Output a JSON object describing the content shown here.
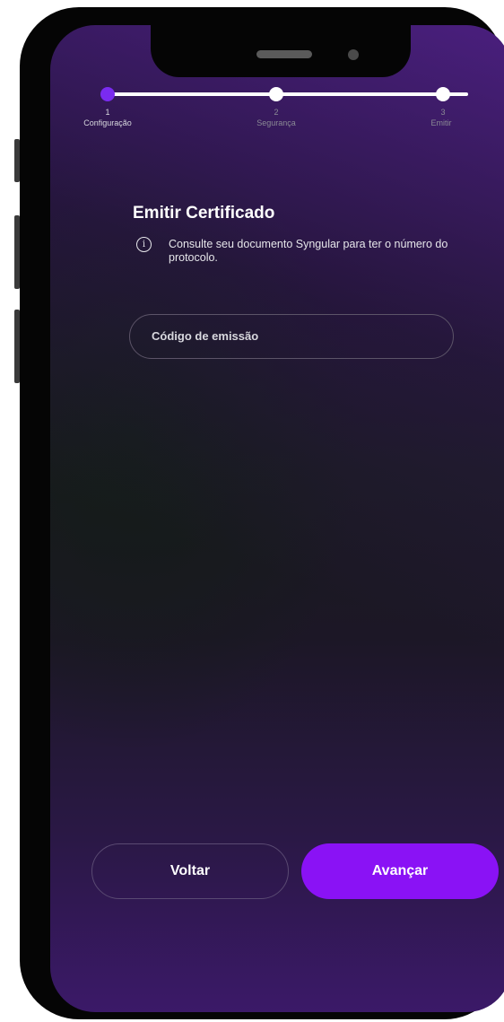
{
  "stepper": {
    "steps": [
      {
        "number": "1",
        "label": "Configuração"
      },
      {
        "number": "2",
        "label": "Segurança"
      },
      {
        "number": "3",
        "label": "Emitir"
      }
    ],
    "active_step": 1
  },
  "page": {
    "title": "Emitir Certificado",
    "info_text": "Consulte seu documento Syngular para ter o número do protocolo.",
    "info_icon": "info-icon"
  },
  "form": {
    "code_placeholder": "Código de emissão"
  },
  "actions": {
    "back_label": "Voltar",
    "next_label": "Avançar"
  },
  "colors": {
    "accent": "#8a12f5",
    "step_active": "#7a2bf0",
    "step_inactive": "#ffffff"
  }
}
